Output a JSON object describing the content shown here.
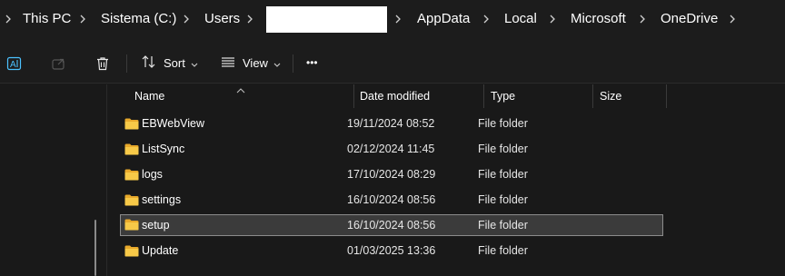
{
  "breadcrumb": {
    "items": [
      {
        "label": "This PC"
      },
      {
        "label": "Sistema (C:)"
      },
      {
        "label": "Users"
      },
      {
        "label": ""
      },
      {
        "label": "AppData"
      },
      {
        "label": "Local"
      },
      {
        "label": "Microsoft"
      },
      {
        "label": "OneDrive"
      }
    ]
  },
  "toolbar": {
    "sort_label": "Sort",
    "view_label": "View",
    "more_label": "•••"
  },
  "columns": {
    "name": "Name",
    "date_modified": "Date modified",
    "type": "Type",
    "size": "Size"
  },
  "files": [
    {
      "name": "EBWebView",
      "date": "19/11/2024 08:52",
      "type": "File folder",
      "size": ""
    },
    {
      "name": "ListSync",
      "date": "02/12/2024 11:45",
      "type": "File folder",
      "size": ""
    },
    {
      "name": "logs",
      "date": "17/10/2024 08:29",
      "type": "File folder",
      "size": ""
    },
    {
      "name": "settings",
      "date": "16/10/2024 08:56",
      "type": "File folder",
      "size": ""
    },
    {
      "name": "setup",
      "date": "16/10/2024 08:56",
      "type": "File folder",
      "size": "",
      "selected": true
    },
    {
      "name": "Update",
      "date": "01/03/2025 13:36",
      "type": "File folder",
      "size": ""
    }
  ],
  "icons": {
    "folder": "folder-icon",
    "breadcrumb_separator": "chevron-right-icon",
    "rename": "rename-icon",
    "share": "share-icon",
    "delete": "delete-icon",
    "sort": "sort-icon",
    "view": "view-icon",
    "more": "more-icon"
  },
  "colors": {
    "background": "#191919",
    "toolbar": "#1c1c1c",
    "selection": "#3b3b3b",
    "folder_yellow": "#f5c342",
    "accent_blue": "#4cc2ff"
  }
}
